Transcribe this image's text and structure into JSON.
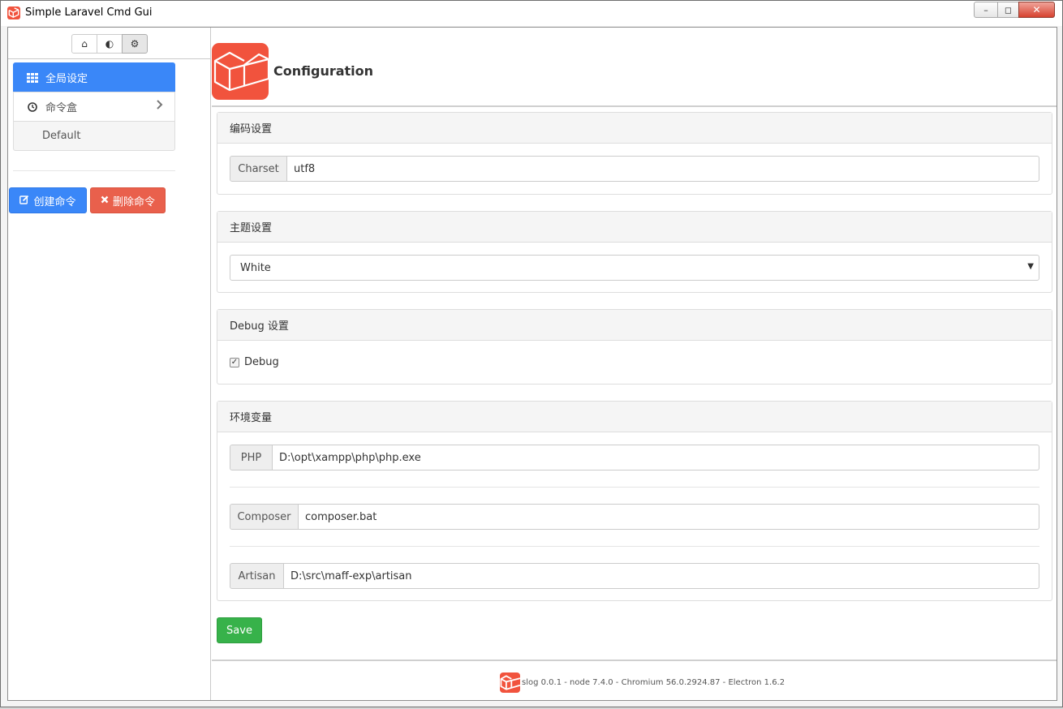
{
  "window": {
    "title": "Simple Laravel Cmd Gui",
    "controls": {
      "minimize": "–",
      "maximize": "◻",
      "close": "✕"
    }
  },
  "toolbar": {
    "buttons": [
      {
        "icon": "home-icon",
        "glyph": "⌂"
      },
      {
        "icon": "contrast-icon",
        "glyph": "◐"
      },
      {
        "icon": "gears-icon",
        "glyph": "⚙"
      }
    ]
  },
  "sidebar": {
    "items": [
      {
        "label": "全局设定",
        "icon": "grid-icon",
        "active": true
      },
      {
        "label": "命令盒",
        "icon": "clock-icon",
        "has_chevron": true
      },
      {
        "label": "Default",
        "sub": true
      }
    ],
    "create_label": "创建命令",
    "delete_label": "删除命令"
  },
  "main": {
    "title": "Configuration",
    "panels": {
      "charset": {
        "heading": "编码设置",
        "addon": "Charset",
        "value": "utf8"
      },
      "theme": {
        "heading": "主题设置",
        "selected": "White"
      },
      "debug": {
        "heading": "Debug 设置",
        "checkbox_label": "Debug",
        "checked": true
      },
      "env": {
        "heading": "环境变量",
        "fields": [
          {
            "addon": "PHP",
            "value": "D:\\opt\\xampp\\php\\php.exe"
          },
          {
            "addon": "Composer",
            "value": "composer.bat"
          },
          {
            "addon": "Artisan",
            "value": "D:\\src\\maff-exp\\artisan"
          }
        ]
      }
    },
    "save_label": "Save"
  },
  "footer": {
    "text": "slog 0.0.1 - node 7.4.0 - Chromium 56.0.2924.87 - Electron 1.6.2"
  },
  "colors": {
    "primary": "#3a87f8",
    "danger": "#e9604c",
    "success": "#37b24a",
    "laravel": "#f1533d"
  }
}
